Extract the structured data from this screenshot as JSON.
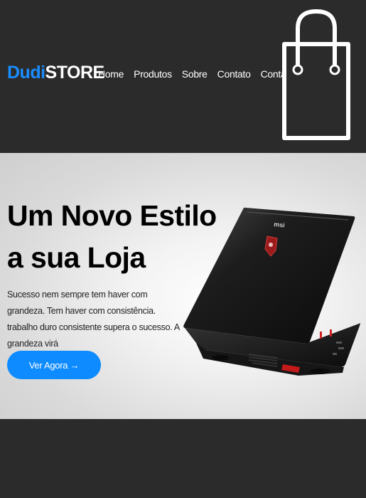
{
  "brand": {
    "part1": "Dudi",
    "part2": "STORE"
  },
  "nav": {
    "items": [
      "Home",
      "Produtos",
      "Sobre",
      "Contato",
      "Conta"
    ]
  },
  "header": {
    "cart_icon": "shopping-bag-icon"
  },
  "hero": {
    "title_line1": "Um Novo Estilo",
    "title_line2": "a sua Loja",
    "description": "Sucesso nem sempre tem haver com grandeza. Tem haver com consistência. trabalho duro consistente supera o sucesso. A grandeza virá",
    "cta_label": "Ver Agora →",
    "product_image": "gaming-laptop-image"
  },
  "colors": {
    "accent": "#0d8bff",
    "dark_bg": "#2b2b2b"
  }
}
